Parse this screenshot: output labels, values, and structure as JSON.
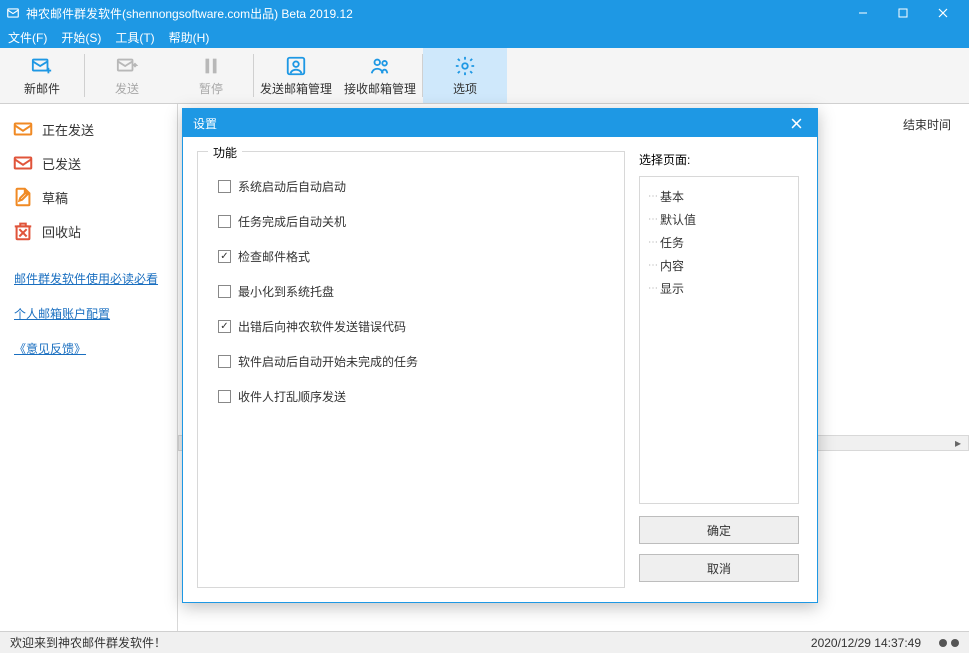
{
  "window": {
    "title": "神农邮件群发软件(shennongsoftware.com出品) Beta 2019.12"
  },
  "menubar": {
    "file": "文件(F)",
    "start": "开始(S)",
    "tools": "工具(T)",
    "help": "帮助(H)"
  },
  "toolbar": {
    "new_mail": "新邮件",
    "send": "发送",
    "pause": "暂停",
    "send_mgmt": "发送邮箱管理",
    "recv_mgmt": "接收邮箱管理",
    "options": "选项"
  },
  "sidebar": {
    "items": [
      {
        "label": "正在发送"
      },
      {
        "label": "已发送"
      },
      {
        "label": "草稿"
      },
      {
        "label": "回收站"
      }
    ],
    "links": [
      "邮件群发软件使用必读必看",
      "个人邮箱账户配置",
      "《意见反馈》"
    ]
  },
  "content": {
    "col_end_time": "结束时间"
  },
  "dialog": {
    "title": "设置",
    "group_label": "功能",
    "options": [
      {
        "label": "系统启动后自动启动",
        "checked": false
      },
      {
        "label": "任务完成后自动关机",
        "checked": false
      },
      {
        "label": "检查邮件格式",
        "checked": true
      },
      {
        "label": "最小化到系统托盘",
        "checked": false
      },
      {
        "label": "出错后向神农软件发送错误代码",
        "checked": true
      },
      {
        "label": "软件启动后自动开始未完成的任务",
        "checked": false
      },
      {
        "label": "收件人打乱顺序发送",
        "checked": false
      }
    ],
    "select_page_label": "选择页面:",
    "pages": [
      "基本",
      "默认值",
      "任务",
      "内容",
      "显示"
    ],
    "ok": "确定",
    "cancel": "取消"
  },
  "statusbar": {
    "welcome": "欢迎来到神农邮件群发软件！",
    "datetime": "2020/12/29 14:37:49"
  }
}
